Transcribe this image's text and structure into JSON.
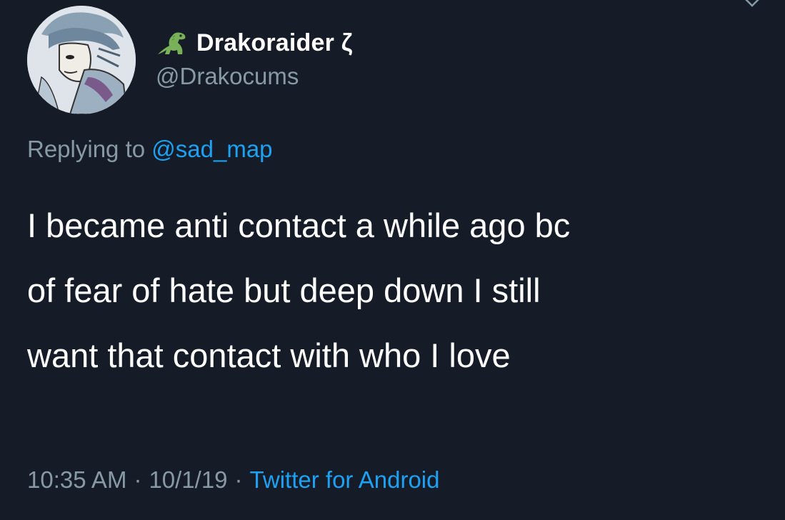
{
  "author": {
    "display_name": "Drakoraider ζ",
    "handle": "@Drakocums",
    "name_icon": "dinosaur-emoji-icon",
    "avatar": "anime-character-avatar"
  },
  "reply": {
    "prefix": "Replying to",
    "mention": "@sad_map"
  },
  "tweet": {
    "lines": [
      "I became anti contact a while ago bc",
      "of fear of hate but deep down I still",
      "want that contact with who I love"
    ]
  },
  "meta": {
    "time": "10:35 AM",
    "date": "10/1/19",
    "separator": "·",
    "source": "Twitter for Android"
  },
  "colors": {
    "background": "#151c28",
    "text": "#ffffff",
    "secondary": "#8899a6",
    "link": "#1da1f2"
  }
}
